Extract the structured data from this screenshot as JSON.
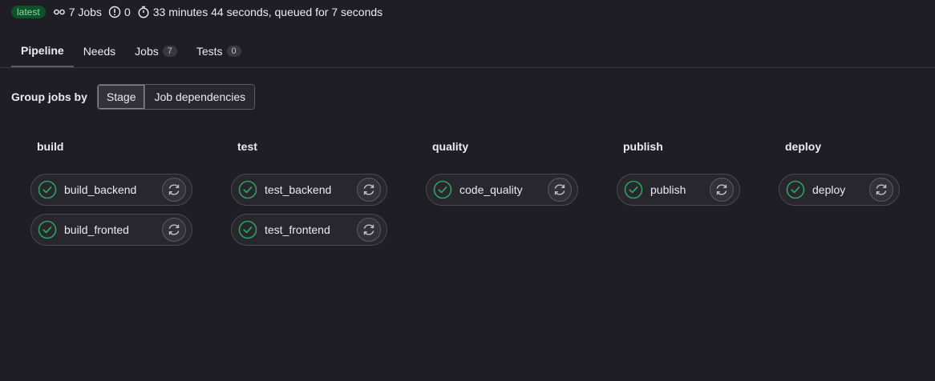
{
  "header": {
    "badge": "latest",
    "jobs_count": "7 Jobs",
    "warnings": "0",
    "duration": "33 minutes 44 seconds, queued for 7 seconds"
  },
  "tabs": [
    {
      "label": "Pipeline",
      "count": null,
      "active": true
    },
    {
      "label": "Needs",
      "count": null,
      "active": false
    },
    {
      "label": "Jobs",
      "count": "7",
      "active": false
    },
    {
      "label": "Tests",
      "count": "0",
      "active": false
    }
  ],
  "grouping": {
    "label": "Group jobs by",
    "options": [
      "Stage",
      "Job dependencies"
    ],
    "selected": "Stage"
  },
  "stages": [
    {
      "name": "build",
      "jobs": [
        "build_backend",
        "build_fronted"
      ]
    },
    {
      "name": "test",
      "jobs": [
        "test_backend",
        "test_frontend"
      ]
    },
    {
      "name": "quality",
      "jobs": [
        "code_quality"
      ]
    },
    {
      "name": "publish",
      "jobs": [
        "publish"
      ]
    },
    {
      "name": "deploy",
      "jobs": [
        "deploy"
      ]
    }
  ],
  "icons": {
    "job_status": "check-circle-icon",
    "job_action": "retry-icon",
    "jobs_meta": "pipeline-icon",
    "warnings_meta": "warning-icon",
    "duration_meta": "timer-icon"
  },
  "colors": {
    "success": "#2da160",
    "badge_bg": "#0d532a",
    "badge_text": "#91d4a8",
    "background": "#1f1e24"
  }
}
